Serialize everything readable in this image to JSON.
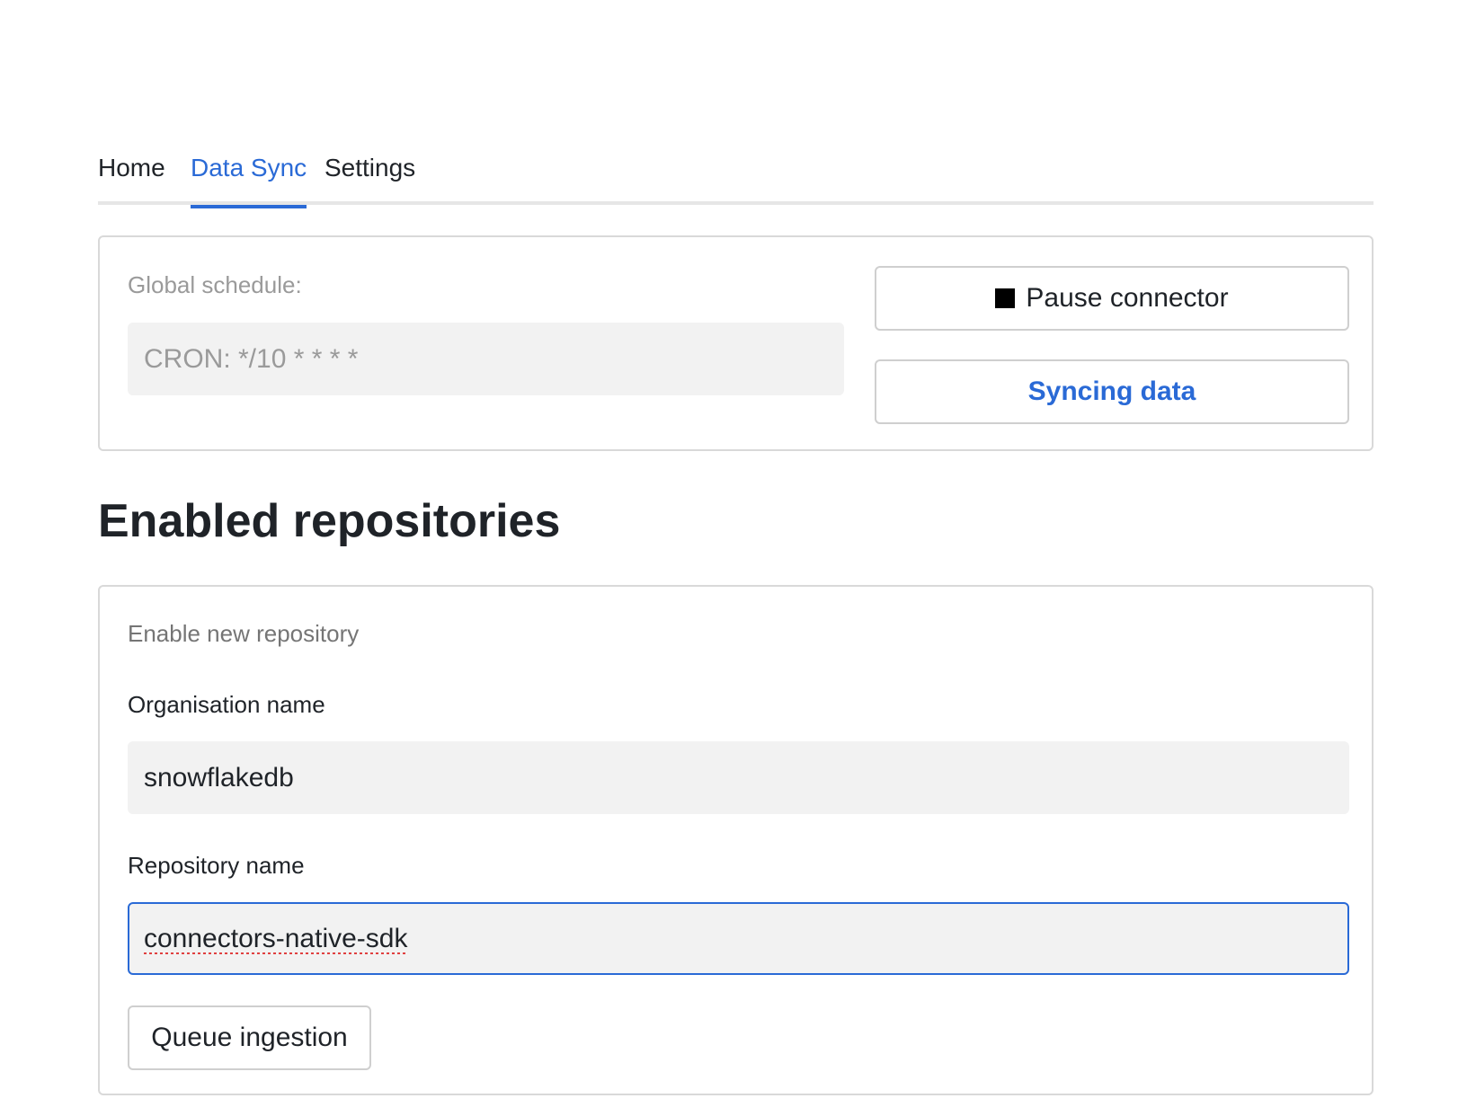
{
  "tabs": [
    {
      "label": "Home",
      "active": false
    },
    {
      "label": "Data Sync",
      "active": true
    },
    {
      "label": "Settings",
      "active": false
    }
  ],
  "schedule": {
    "label": "Global schedule:",
    "cron_value": "CRON: */10 * * * *",
    "pause_button_label": "Pause connector",
    "pause_icon": "stop-icon",
    "sync_button_label": "Syncing data"
  },
  "repositories": {
    "heading": "Enabled repositories",
    "form_title": "Enable new repository",
    "org_label": "Organisation name",
    "org_value": "snowflakedb",
    "repo_label": "Repository name",
    "repo_value": "connectors-native-sdk",
    "queue_button_label": "Queue ingestion"
  },
  "colors": {
    "accent": "#2a6ad6",
    "field_bg": "#f2f2f2",
    "border": "#d9d9d9"
  }
}
